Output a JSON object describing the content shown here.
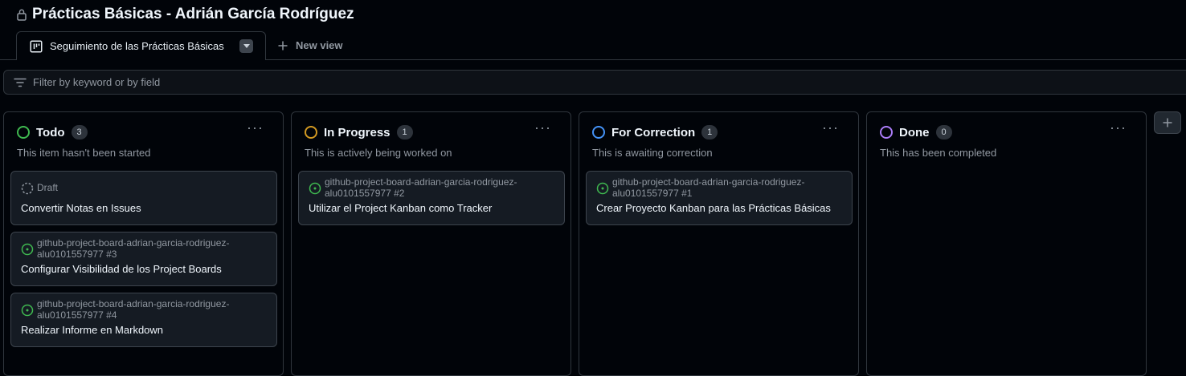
{
  "project": {
    "title": "Prácticas Básicas - Adrián García Rodríguez"
  },
  "tabs": {
    "active_label": "Seguimiento de las Prácticas Básicas",
    "new_view_label": "New view"
  },
  "filter": {
    "placeholder": "Filter by keyword or by field"
  },
  "colors": {
    "todo": "#3fb950",
    "in_progress": "#d29922",
    "for_correction": "#4493f8",
    "done": "#ab7df8",
    "issue_open": "#3fb950"
  },
  "columns": [
    {
      "name": "Todo",
      "count": "3",
      "description": "This item hasn't been started",
      "menu": "···",
      "cards": [
        {
          "kind": "draft",
          "meta": "Draft",
          "title": "Convertir Notas en Issues"
        },
        {
          "kind": "issue",
          "repo": "github-project-board-adrian-garcia-rodriguez-",
          "repo2": "alu0101557977 #3",
          "title": "Configurar Visibilidad de los Project Boards"
        },
        {
          "kind": "issue",
          "repo": "github-project-board-adrian-garcia-rodriguez-",
          "repo2": "alu0101557977 #4",
          "title": "Realizar Informe en Markdown"
        }
      ]
    },
    {
      "name": "In Progress",
      "count": "1",
      "description": "This is actively being worked on",
      "menu": "···",
      "cards": [
        {
          "kind": "issue",
          "repo": "github-project-board-adrian-garcia-rodriguez-",
          "repo2": "alu0101557977 #2",
          "title": "Utilizar el Project Kanban como Tracker"
        }
      ]
    },
    {
      "name": "For Correction",
      "count": "1",
      "description": "This is awaiting correction",
      "menu": "···",
      "cards": [
        {
          "kind": "issue",
          "repo": "github-project-board-adrian-garcia-rodriguez-",
          "repo2": "alu0101557977 #1",
          "title": "Crear Proyecto Kanban para las Prácticas Básicas"
        }
      ]
    },
    {
      "name": "Done",
      "count": "0",
      "description": "This has been completed",
      "menu": "···",
      "cards": []
    }
  ],
  "icons": [
    "lock-icon",
    "board-icon",
    "chevron-down-icon",
    "plus-icon",
    "filter-icon",
    "kebab-icon",
    "issue-open-icon",
    "draft-icon"
  ]
}
